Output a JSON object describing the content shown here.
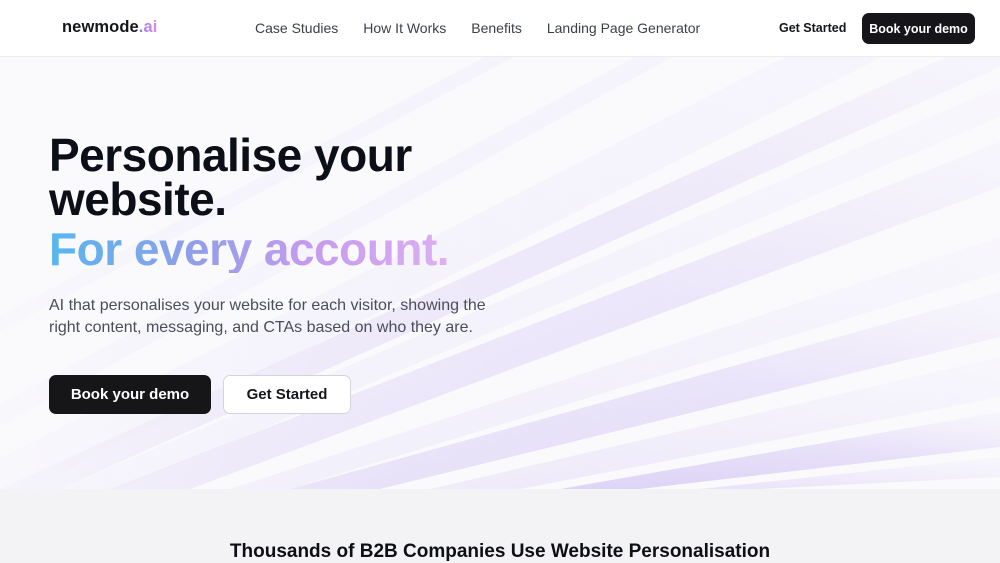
{
  "nav": {
    "logo_main": "newmode",
    "logo_suffix": ".ai",
    "links": [
      "Case Studies",
      "How It Works",
      "Benefits",
      "Landing Page Generator"
    ],
    "get_started": "Get Started",
    "book_demo": "Book your demo"
  },
  "hero": {
    "title_line1": "Personalise your",
    "title_line2": "website.",
    "accent": "For every account.",
    "subtitle": "AI that personalises your website for each visitor, showing the right content, messaging, and CTAs based on who they are.",
    "primary_button": "Book your demo",
    "secondary_button": "Get Started"
  },
  "section": {
    "title": "Thousands of B2B Companies Use Website Personalisation"
  },
  "colors": {
    "dark_button": "#15151a",
    "accent_blue": "#56b7ef",
    "accent_purple": "#c59bee",
    "stripe": "#c9b6f2"
  }
}
